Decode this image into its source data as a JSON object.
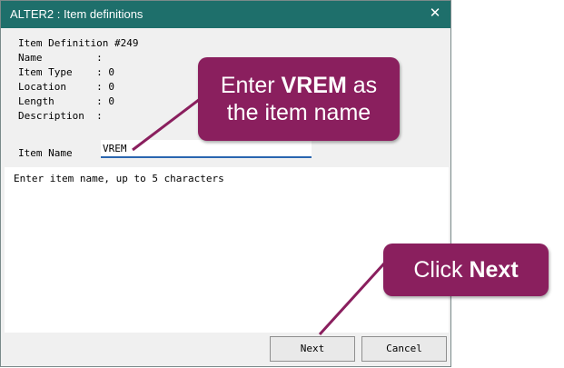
{
  "window": {
    "title": "ALTER2 : Item definitions",
    "close_glyph": "✕"
  },
  "definition": {
    "lines": [
      "Item Definition #249",
      "Name         :",
      "Item Type    : 0",
      "Location     : 0",
      "Length       : 0",
      "Description  :"
    ]
  },
  "item_name": {
    "label": "Item Name",
    "value": "VREM"
  },
  "message": {
    "text": "Enter item name, up to 5 characters"
  },
  "buttons": {
    "next_label": "Next",
    "cancel_label": "Cancel"
  },
  "callouts": {
    "name_prefix": "Enter ",
    "name_bold": "VREM",
    "name_suffix": " as",
    "name_line2": "the item name",
    "next_prefix": "Click ",
    "next_bold": "Next"
  },
  "colors": {
    "titlebar": "#1e6f6b",
    "callout": "#8a1f5e",
    "input_underline": "#2a66b0"
  }
}
